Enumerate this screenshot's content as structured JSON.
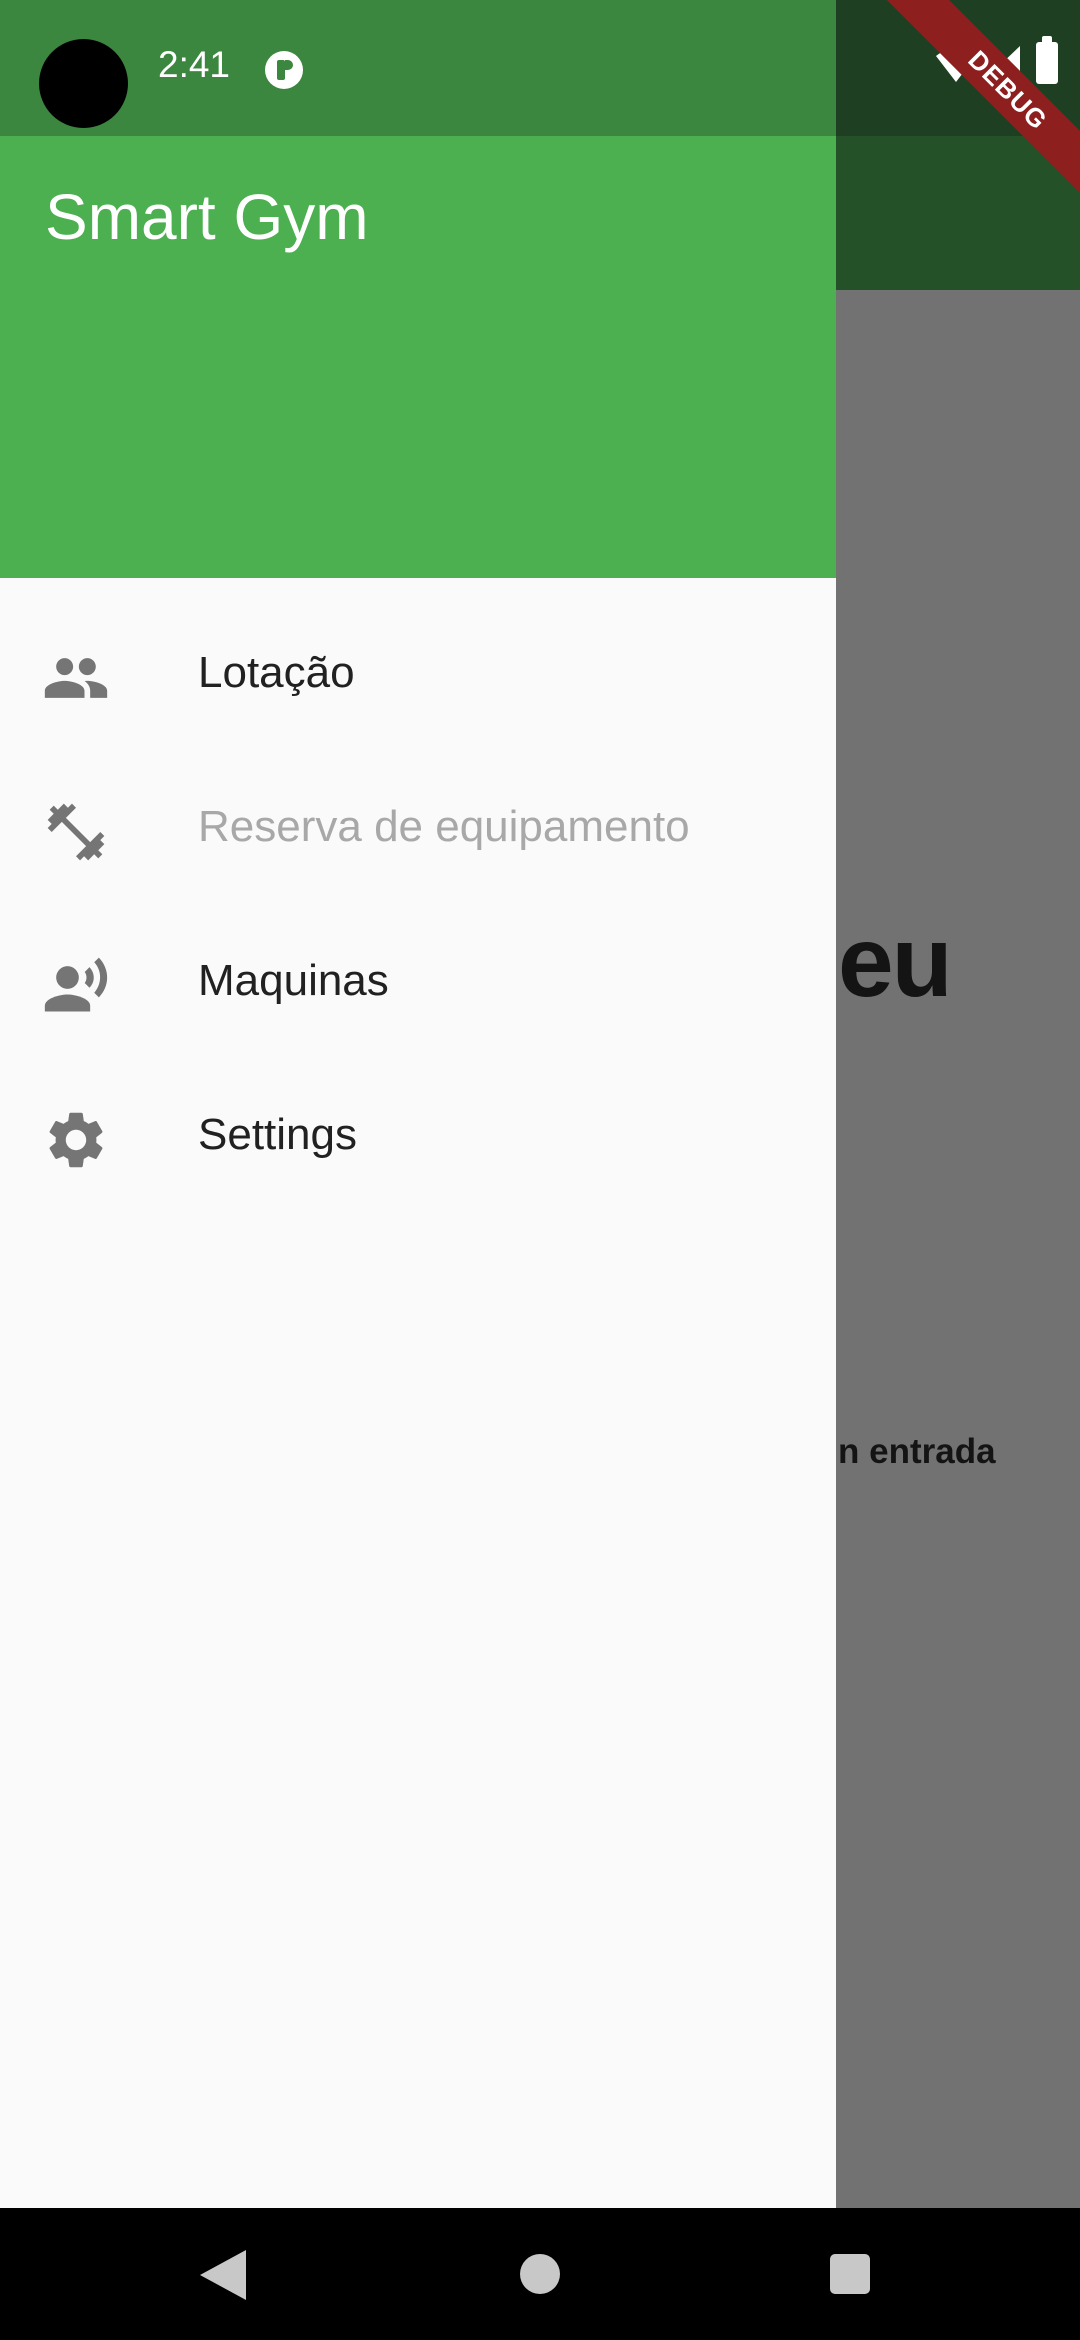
{
  "status_bar": {
    "time": "2:41"
  },
  "debug_banner": {
    "label": "DEBUG"
  },
  "background_app": {
    "heading_fragment": "eu",
    "subtext_fragment": "n entrada"
  },
  "drawer": {
    "header_title": "Smart Gym",
    "items": [
      {
        "label": "Lotação",
        "icon": "people-icon",
        "disabled": false
      },
      {
        "label": "Reserva de equipamento",
        "icon": "fitness-center-icon",
        "disabled": true
      },
      {
        "label": "Maquinas",
        "icon": "person-signal-icon",
        "disabled": false
      },
      {
        "label": "Settings",
        "icon": "gear-icon",
        "disabled": false
      }
    ]
  },
  "colors": {
    "drawer_header": "#4caf50",
    "status_bar_left": "#3c873f",
    "app_bar": "#245128",
    "scrim": "#727272",
    "debug_banner": "#8e1f1f"
  }
}
